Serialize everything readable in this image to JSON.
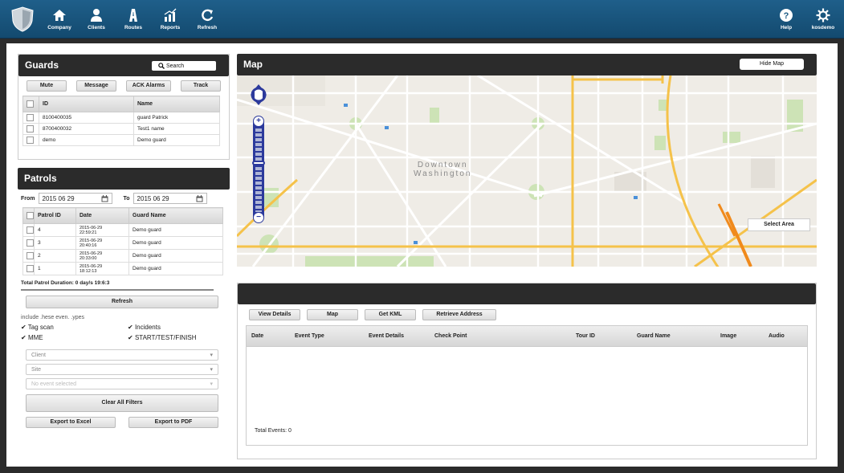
{
  "nav": {
    "items": [
      {
        "label": "Company",
        "icon": "home-icon"
      },
      {
        "label": "Clients",
        "icon": "user-icon"
      },
      {
        "label": "Routes",
        "icon": "routes-icon"
      },
      {
        "label": "Reports",
        "icon": "chart-icon"
      },
      {
        "label": "Refresh",
        "icon": "refresh-icon"
      }
    ],
    "right": [
      {
        "label": "Help",
        "icon": "help-icon"
      },
      {
        "label": "kosdemo",
        "icon": "gear-icon"
      }
    ]
  },
  "guards": {
    "title": "Guards",
    "search_label": "Search",
    "buttons": [
      "Mute",
      "Message",
      "ACK Alarms",
      "Track"
    ],
    "columns": [
      "ID",
      "Name"
    ],
    "rows": [
      {
        "id": "8100400035",
        "name": "guard Patrick"
      },
      {
        "id": "8700400032",
        "name": "Test1 name"
      },
      {
        "id": "demo",
        "name": "Demo guard"
      }
    ]
  },
  "patrols": {
    "title": "Patrols",
    "from_label": "From",
    "from_value": "2015 06 29",
    "to_label": "To",
    "to_value": "2015 06 29",
    "columns": [
      "Patrol ID",
      "Date",
      "Guard Name"
    ],
    "rows": [
      {
        "id": "4",
        "date1": "2015-06-29",
        "date2": "22:59:21",
        "guard": "Demo guard"
      },
      {
        "id": "3",
        "date1": "2015-06-29",
        "date2": "20:40:16",
        "guard": "Demo guard"
      },
      {
        "id": "2",
        "date1": "2015-06-29",
        "date2": "20:33:00",
        "guard": "Demo guard"
      },
      {
        "id": "1",
        "date1": "2015-06-29",
        "date2": "18:12:13",
        "guard": "Demo guard"
      }
    ],
    "total_duration": "Total Patrol Duration: 0 day/s 19:6:3",
    "refresh_label": "Refresh",
    "include_label": "include .hese even. .ypes",
    "checks": [
      "Tag scan",
      "Incidents",
      "MME",
      "START/TEST/FINISH"
    ],
    "client_placeholder": "Client",
    "site_placeholder": "Site",
    "event_placeholder": "No event selected",
    "clear_label": "Clear All Filters",
    "export_excel": "Export to Excel",
    "export_pdf": "Export to PDF"
  },
  "map": {
    "title": "Map",
    "hide_label": "Hide Map",
    "select_area_label": "Select Area",
    "city_label_1": "Downtown",
    "city_label_2": "Washington"
  },
  "events": {
    "buttons": [
      "View Details",
      "Map",
      "Get KML",
      "Retrieve Address"
    ],
    "columns": [
      "Date",
      "Event Type",
      "Event Details",
      "Check Point",
      "Tour ID",
      "Guard Name",
      "Image",
      "Audio"
    ],
    "total": "Total Events: 0"
  },
  "colors": {
    "topbar": "#1b5a84",
    "panel_header": "#2b2b2b",
    "road_yellow": "#f5c24a",
    "road_orange": "#f08a1c",
    "park_green": "#cde3b6"
  }
}
